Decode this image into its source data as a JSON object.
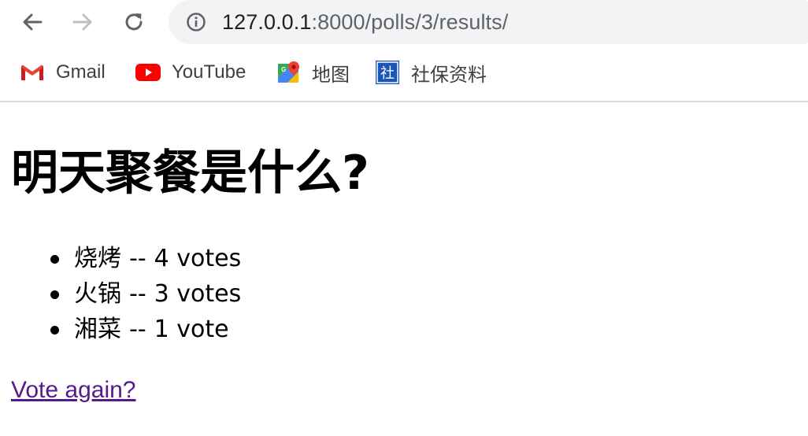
{
  "browser": {
    "url_host": "127.0.0.1",
    "url_path": ":8000/polls/3/results/",
    "icons": {
      "back": "arrow-left-icon",
      "forward": "arrow-right-icon",
      "reload": "reload-icon",
      "info": "info-icon"
    }
  },
  "bookmarks": [
    {
      "label": "Gmail",
      "icon": "gmail-icon"
    },
    {
      "label": "YouTube",
      "icon": "youtube-icon"
    },
    {
      "label": "地图",
      "icon": "maps-icon"
    },
    {
      "label": "社保资料",
      "icon": "shebao-icon",
      "icon_text": "社"
    }
  ],
  "page": {
    "question": "明天聚餐是什么?",
    "results": [
      {
        "choice": "烧烤",
        "separator": "--",
        "votes": "4 votes"
      },
      {
        "choice": "火锅",
        "separator": "--",
        "votes": "3 votes"
      },
      {
        "choice": "湘菜",
        "separator": "--",
        "votes": "1 vote"
      }
    ],
    "vote_again": "Vote again?"
  },
  "colors": {
    "link_visited": "#551a8b",
    "omnibox_bg": "#f1f3f4",
    "youtube_red": "#ff0000",
    "shebao_blue": "#1a56b8"
  }
}
